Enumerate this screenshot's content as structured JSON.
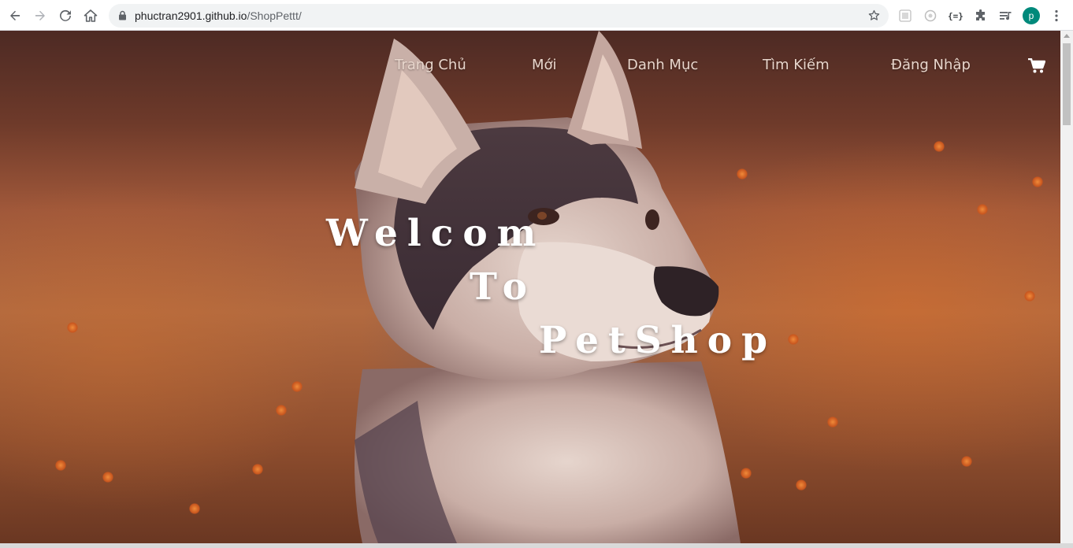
{
  "browser": {
    "url_host": "phuctran2901.github.io",
    "url_path": "/ShopPettt/",
    "profile_initial": "p",
    "icons": {
      "back": "back-arrow-icon",
      "forward": "forward-arrow-icon",
      "reload": "reload-icon",
      "home": "home-icon",
      "lock": "lock-icon",
      "bookmark": "star-icon",
      "extensions": "puzzle-icon",
      "media": "media-queue-icon",
      "menu": "kebab-menu-icon"
    }
  },
  "nav": {
    "items": [
      {
        "label": "Trang Chủ"
      },
      {
        "label": "Mới"
      },
      {
        "label": "Danh Mục"
      },
      {
        "label": "Tìm Kiếm"
      },
      {
        "label": "Đăng Nhập"
      }
    ],
    "cart_icon": "shopping-cart-icon"
  },
  "hero": {
    "line1": "Welcom",
    "line2": "To",
    "line3": "PetShop"
  },
  "colors": {
    "hero_text": "#ffffff",
    "nav_text": "#e8d6cc",
    "profile_bg": "#00897b"
  }
}
